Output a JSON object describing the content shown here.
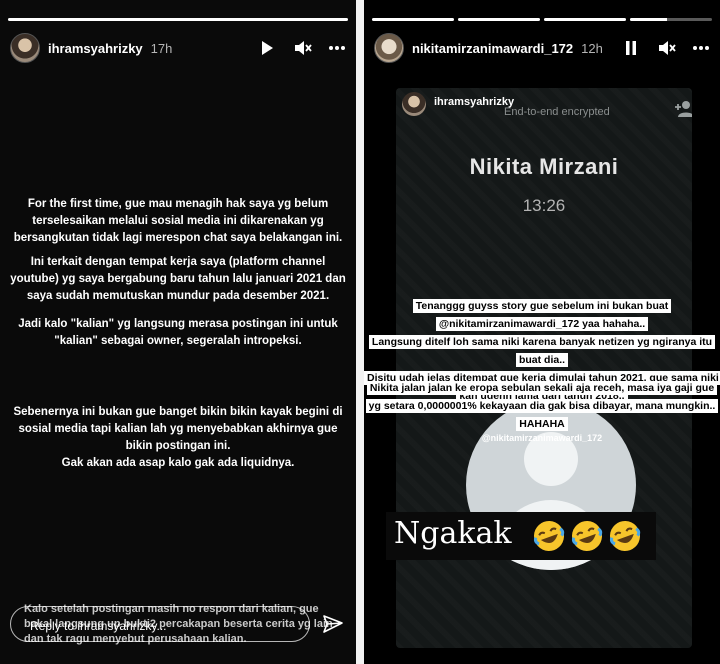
{
  "left_story": {
    "progress": [
      1
    ],
    "username": "ihramsyahrizky",
    "time": "17h",
    "icons": [
      "play-icon",
      "mute-icon",
      "more-icon"
    ],
    "paragraphs": [
      "For the first time, gue mau menagih hak saya yg belum terselesaikan melalui sosial media ini dikarenakan yg bersangkutan tidak lagi merespon chat saya belakangan ini.",
      "Ini terkait dengan tempat kerja saya (platform channel youtube) yg saya bergabung baru tahun lalu januari 2021 dan saya sudah memutuskan mundur pada desember 2021.",
      "Jadi kalo \"kalian\" yg langsung merasa postingan ini untuk \"kalian\" sebagai owner, segeralah intropeksi.",
      "Sebenernya ini bukan gue banget bikin bikin kayak begini di sosial media tapi kalian lah yg menyebabkan akhirnya gue bikin postingan ini.\nGak akan ada asap kalo gak ada liquidnya."
    ],
    "footer_caption": "Kalo setelah postingan masih no respon dari kalian, gue bakal langsung up bukti2 percakapan beserta cerita yg lain dan tak ragu menyebut perusahaan kalian.",
    "reply_placeholder": "Reply to ihramsyahrizky..."
  },
  "right_story": {
    "progress": [
      1,
      1,
      1,
      0.45
    ],
    "username": "nikitamirzanimawardi_172",
    "time": "12h",
    "icons": [
      "pause-icon",
      "mute-icon",
      "more-icon"
    ],
    "screenshot": {
      "chat_user": "ihramsyahrizky",
      "encryption_note": "End-to-end encrypted",
      "contact_name": "Nikita Mirzani",
      "call_time": "13:26"
    },
    "overlay_block_1": [
      "Tenanggg guyss story gue sebelum ini bukan buat @nikitamirzanimawardi_172 yaa hahaha..",
      "Langsung ditelf loh sama niki karena banyak netizen yg ngiranya itu buat dia..",
      "Disitu udah jelas ditempat gue kerja dimulai tahun 2021, gue sama niki kan udehh lama dari tahun 2018.."
    ],
    "overlay_block_2": [
      "Nikita jalan jalan ke eropa sebulan sekali aja receh, masa iya gaji gue yg setara 0,0000001% kekayaan dia gak bisa dibayar, mana mungkin..",
      "HAHAHA"
    ],
    "mention": "@nikitamirzanimawardi_172",
    "sticker_text": "Ngakak",
    "sticker_emoji_count": 3
  }
}
